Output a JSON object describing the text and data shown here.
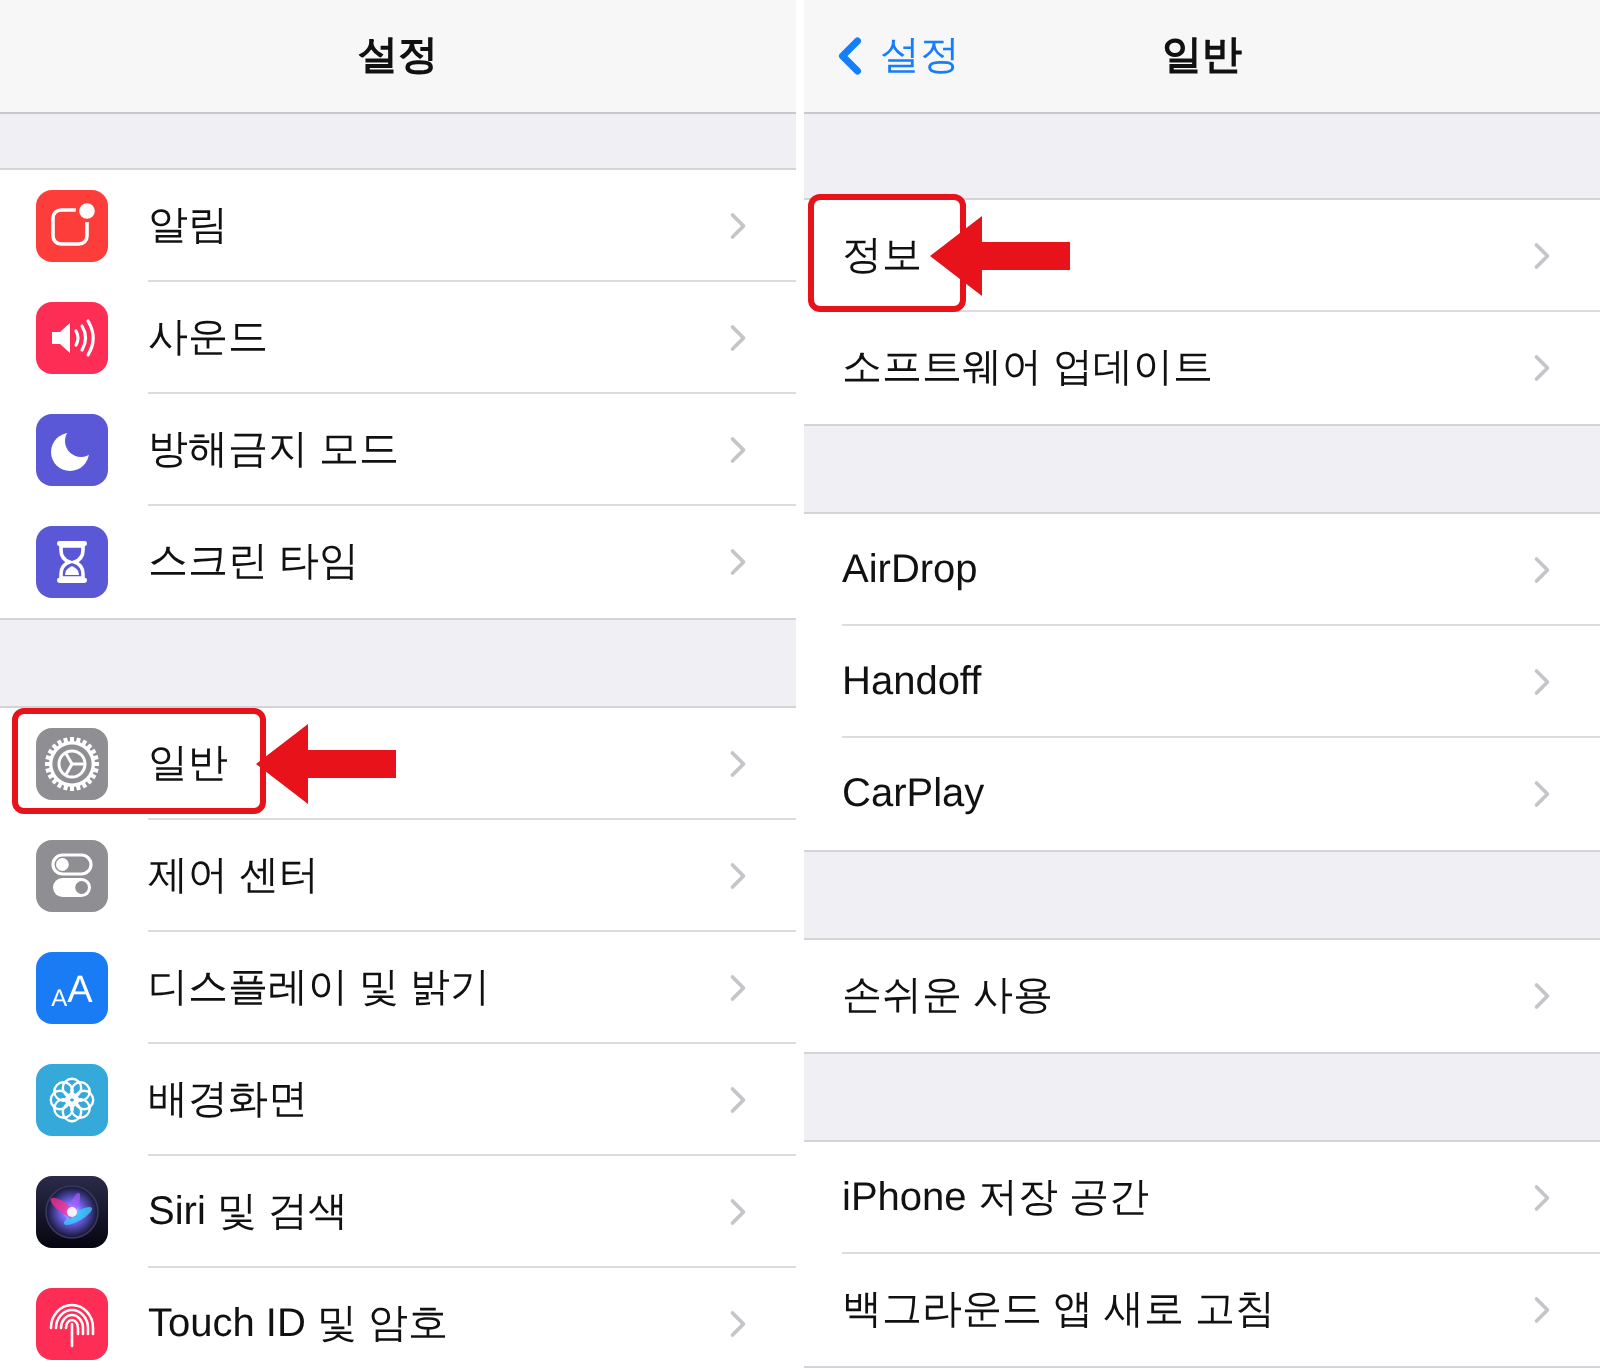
{
  "left_panel": {
    "nav_bar": {
      "title": "설정"
    },
    "groups": [
      {
        "items": [
          {
            "label": "알림",
            "highlighted": false
          },
          {
            "label": "사운드",
            "highlighted": false
          },
          {
            "label": "방해금지 모드",
            "highlighted": false
          },
          {
            "label": "스크린 타임",
            "highlighted": false
          }
        ]
      },
      {
        "items": [
          {
            "label": "일반",
            "highlighted": true
          },
          {
            "label": "제어 센터",
            "highlighted": false
          },
          {
            "label": "디스플레이 및 밝기",
            "highlighted": false,
            "icon_letters": [
              "A",
              "A"
            ]
          },
          {
            "label": "배경화면",
            "highlighted": false
          },
          {
            "label": "Siri 및 검색",
            "highlighted": false
          },
          {
            "label": "Touch ID 및 암호",
            "highlighted": false
          }
        ]
      }
    ]
  },
  "right_panel": {
    "nav_bar": {
      "back_label": "설정",
      "title": "일반"
    },
    "groups": [
      {
        "items": [
          {
            "label": "정보",
            "highlighted": true
          },
          {
            "label": "소프트웨어 업데이트",
            "highlighted": false
          }
        ]
      },
      {
        "items": [
          {
            "label": "AirDrop",
            "highlighted": false
          },
          {
            "label": "Handoff",
            "highlighted": false
          },
          {
            "label": "CarPlay",
            "highlighted": false
          }
        ]
      },
      {
        "items": [
          {
            "label": "손쉬운 사용",
            "highlighted": false
          }
        ]
      },
      {
        "items": [
          {
            "label": "iPhone 저장 공간",
            "highlighted": false
          },
          {
            "label": "백그라운드 앱 새로 고침",
            "highlighted": false
          }
        ]
      }
    ]
  }
}
